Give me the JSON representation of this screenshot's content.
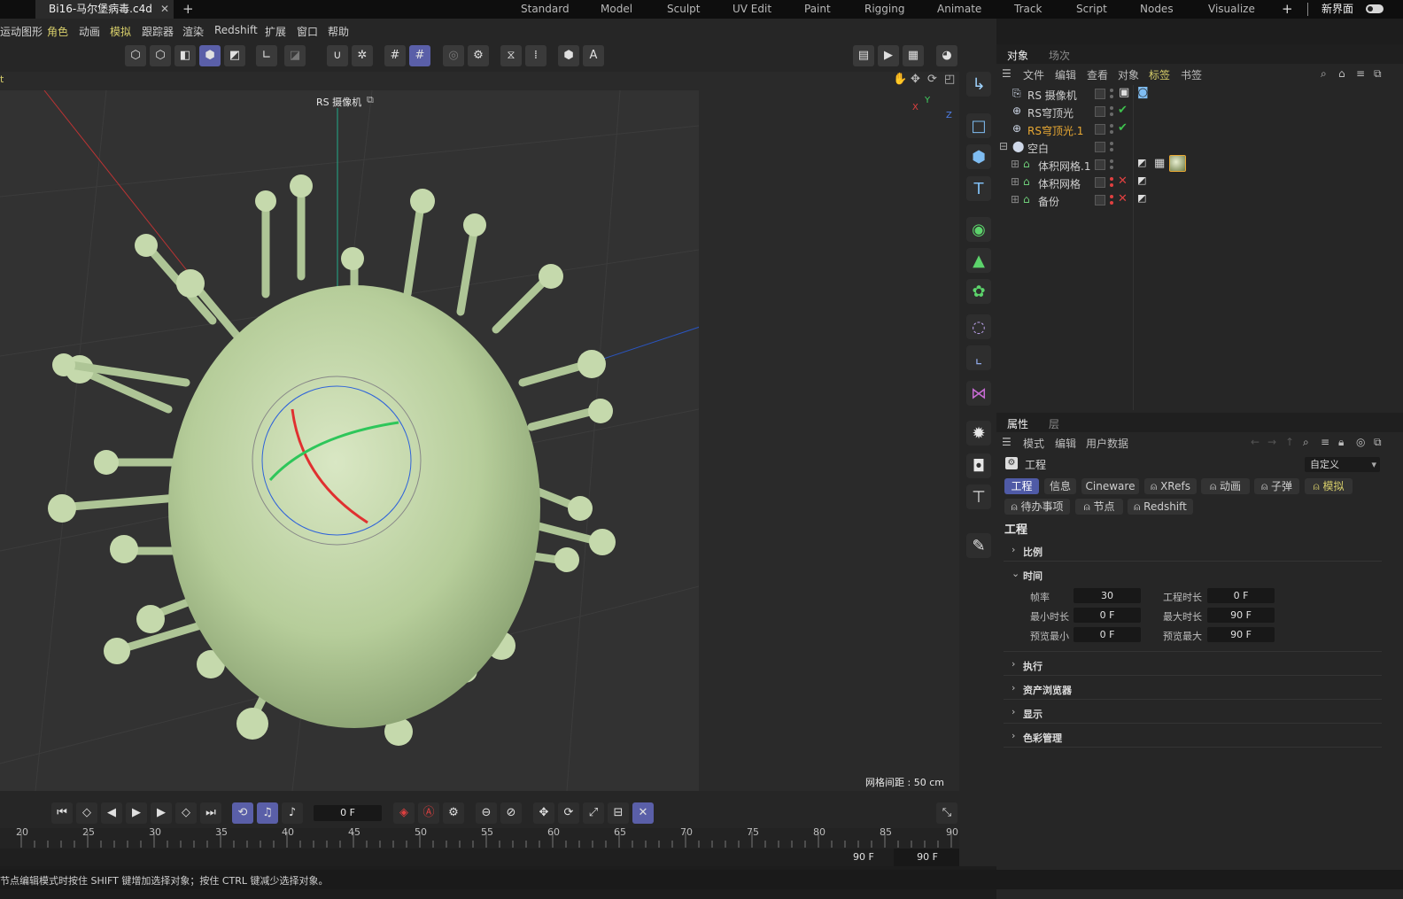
{
  "tabbar": {
    "file_tab": "Bi16-马尔堡病毒.c4d",
    "close_glyph": "✕",
    "new_tab_glyph": "+",
    "layouts": [
      "Standard",
      "Model",
      "Sculpt",
      "UV Edit",
      "Paint",
      "Rigging",
      "Animate",
      "Track",
      "Script",
      "Nodes",
      "Visualize"
    ],
    "add_layout_glyph": "+",
    "new_ui_label": "新界面"
  },
  "menu": {
    "items": [
      "运动图形",
      "角色",
      "动画",
      "模拟",
      "跟踪器",
      "渲染",
      "Redshift",
      "扩展",
      "窗口",
      "帮助"
    ],
    "highlighted": [
      "角色",
      "模拟"
    ]
  },
  "toolbar": {
    "icons": [
      "points-mode-icon",
      "edges-mode-icon",
      "polygons-mode-icon",
      "model-mode-icon",
      "texture-mode-icon",
      "axis-icon",
      "solo-icon",
      "magnet-icon",
      "snap-settings-icon",
      "grid-snap-icon",
      "grid-snap-active-icon",
      "target-icon",
      "gear-target-icon",
      "symmetry-icon",
      "symmetry-settings-icon",
      "visibility-icon",
      "auto-key-icon",
      "render-view-icon",
      "render-icon",
      "render-settings-icon",
      "ar-icon"
    ]
  },
  "viewport": {
    "camera_label": "RS 摄像机",
    "grid_info": "网格间距 : 50 cm",
    "axis_x": "X",
    "axis_y": "Y",
    "axis_z": "Z",
    "corner_label": "t"
  },
  "object_manager": {
    "tabs": [
      "对象",
      "场次"
    ],
    "menu": [
      "文件",
      "编辑",
      "查看",
      "对象",
      "标签",
      "书签"
    ],
    "menu_highlight": "标签",
    "rows": [
      {
        "name": "RS 摄像机",
        "icon": "camera-icon",
        "color": "#cfcfcf",
        "status": "",
        "indent": 0
      },
      {
        "name": "RS穹顶光",
        "icon": "dome-light-icon",
        "color": "#cfcfcf",
        "status": "check",
        "indent": 0
      },
      {
        "name": "RS穹顶光.1",
        "icon": "dome-light-icon",
        "color": "#e8a833",
        "status": "check",
        "indent": 0
      },
      {
        "name": "空白",
        "icon": "null-icon",
        "color": "#cfcfcf",
        "status": "",
        "indent": 0
      },
      {
        "name": "体积网格.1",
        "icon": "volume-mesher-icon",
        "color": "#cfcfcf",
        "status": "",
        "indent": 1
      },
      {
        "name": "体积网格",
        "icon": "volume-mesher-icon",
        "color": "#cfcfcf",
        "status": "x",
        "indent": 1
      },
      {
        "name": "备份",
        "icon": "volume-mesher-icon",
        "color": "#cfcfcf",
        "status": "x",
        "indent": 1
      }
    ]
  },
  "attributes": {
    "tabs": [
      "属性",
      "层"
    ],
    "menu": [
      "模式",
      "编辑",
      "用户数据"
    ],
    "object_label": "工程",
    "preset": "自定义",
    "chips_row1": [
      "工程",
      "信息",
      "Cineware",
      "XRefs",
      "动画",
      "子弹",
      "模拟"
    ],
    "chips_row2": [
      "待办事项",
      "节点",
      "Redshift"
    ],
    "section_title": "工程",
    "groups": [
      "比例",
      "时间",
      "执行",
      "资产浏览器",
      "显示",
      "色彩管理"
    ],
    "time": {
      "fps_label": "帧率",
      "fps": "30",
      "proj_len_label": "工程时长",
      "proj_len": "0 F",
      "min_label": "最小时长",
      "min": "0 F",
      "max_label": "最大时长",
      "max": "90 F",
      "pmin_label": "预览最小",
      "pmin": "0 F",
      "pmax_label": "预览最大",
      "pmax": "90 F"
    }
  },
  "timeline": {
    "current_frame": "0 F",
    "end_frame": "90 F",
    "end_frame2": "90 F",
    "ticks": [
      "20",
      "25",
      "30",
      "35",
      "40",
      "45",
      "50",
      "55",
      "60",
      "65",
      "70",
      "75",
      "80",
      "85",
      "90"
    ]
  },
  "status_text": "节点编辑模式时按住 SHIFT 键增加选择对象；按住 CTRL 键减少选择对象。"
}
